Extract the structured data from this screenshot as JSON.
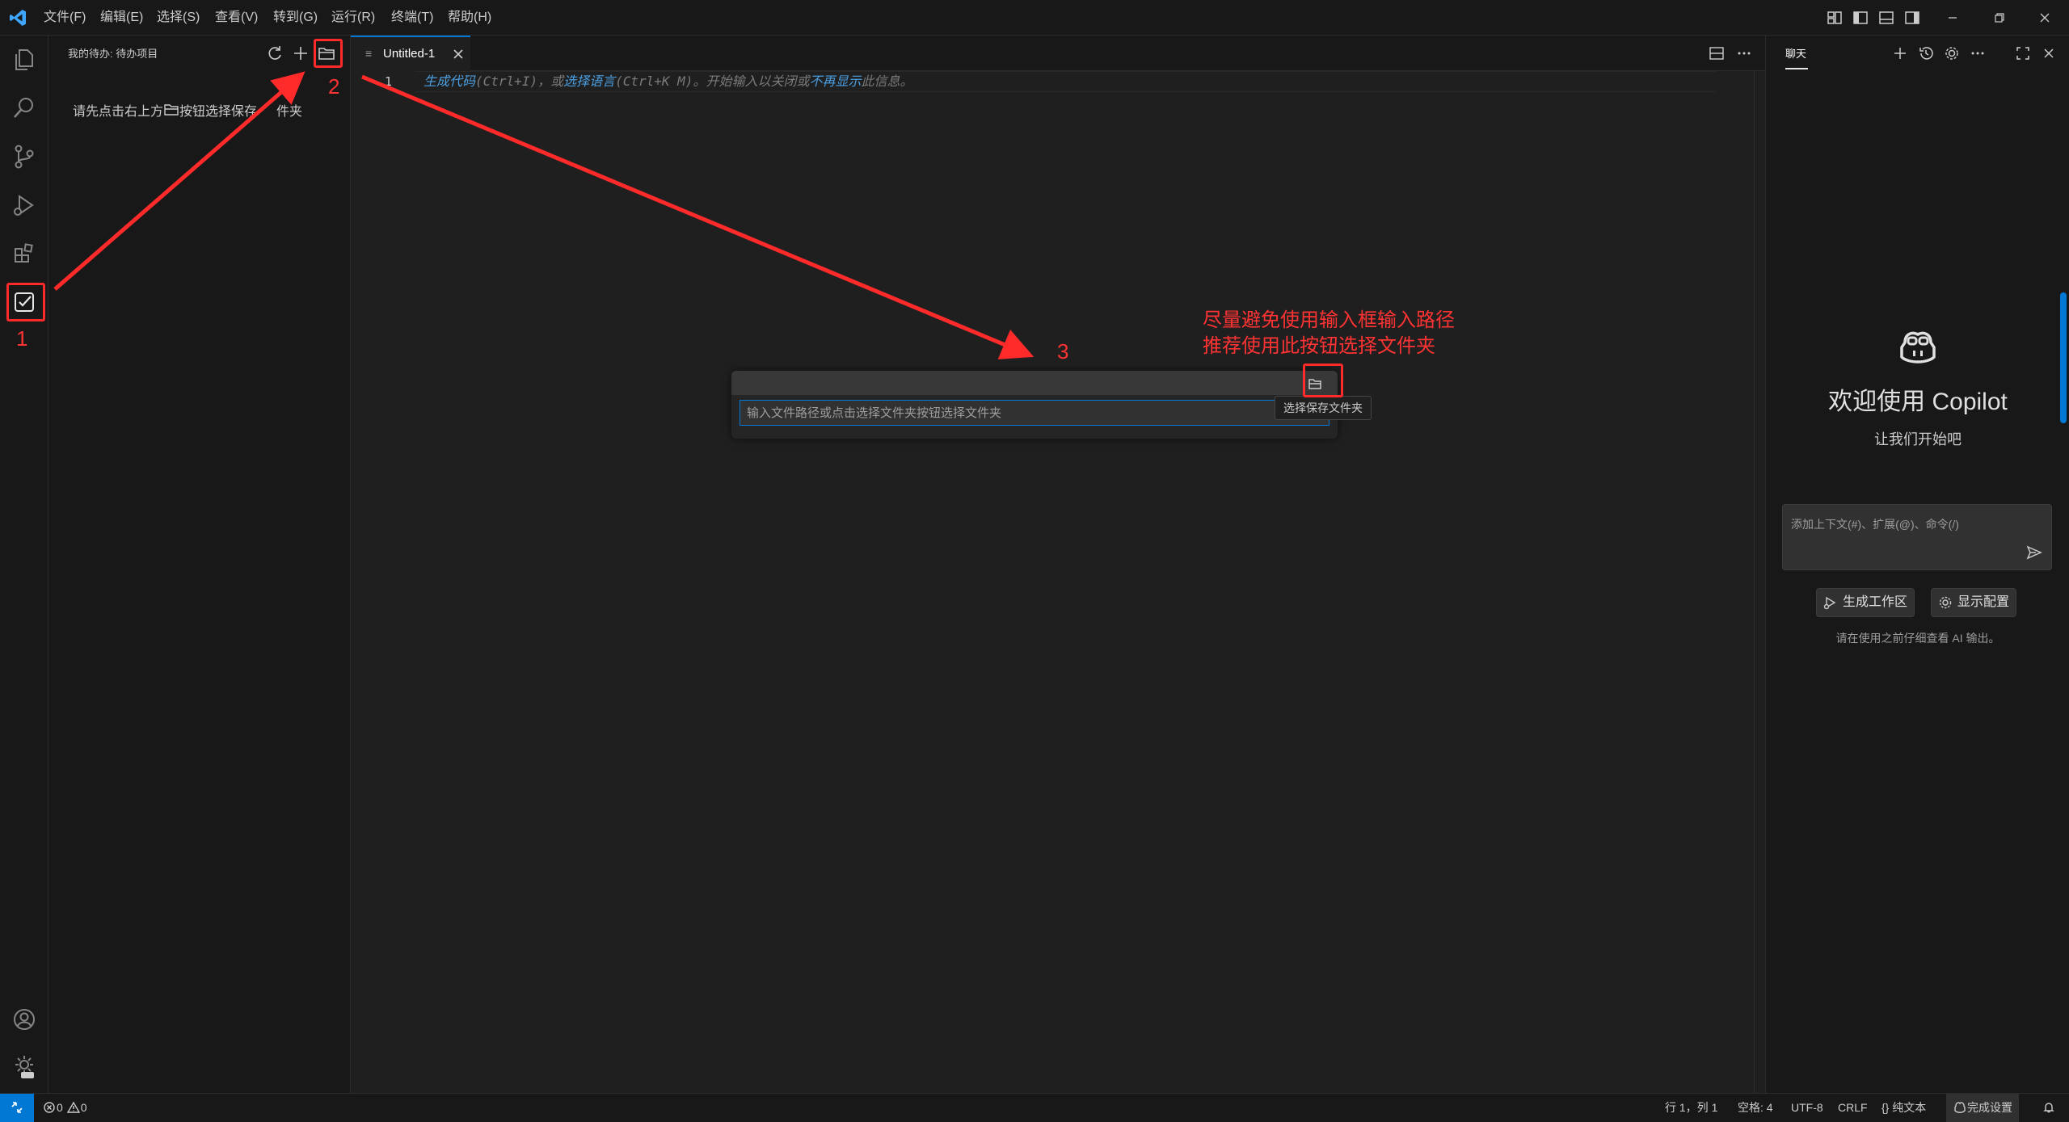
{
  "menu": [
    "文件(F)",
    "编辑(E)",
    "选择(S)",
    "查看(V)",
    "转到(G)",
    "运行(R)",
    "终端(T)",
    "帮助(H)"
  ],
  "sidebar": {
    "title": "我的待办: 待办项目",
    "hint_prefix": "请先点击右上方",
    "hint_suffix": "按钮选择保存",
    "hint_tail": "件夹"
  },
  "editor": {
    "tab_label": "Untitled-1",
    "line_number": "1",
    "hint": {
      "link1": "生成代码",
      "text1": "(Ctrl+I)，或",
      "link2": "选择语言",
      "text2": "(Ctrl+K M)。开始输入以关闭或",
      "link3": "不再显示",
      "text3": "此信息。"
    }
  },
  "quick_input": {
    "placeholder": "输入文件路径或点击选择文件夹按钮选择文件夹",
    "tooltip": "选择保存文件夹"
  },
  "chat": {
    "tab": "聊天",
    "welcome": "欢迎使用 Copilot",
    "subtitle": "让我们开始吧",
    "input_placeholder": "添加上下文(#)、扩展(@)、命令(/)",
    "btn_workspace": "生成工作区",
    "btn_config": "显示配置",
    "note": "请在使用之前仔细查看 AI 输出。"
  },
  "statusbar": {
    "errors": "0",
    "warnings": "0",
    "position": "行 1，列 1",
    "spaces": "空格: 4",
    "encoding": "UTF-8",
    "eol": "CRLF",
    "language": "纯文本",
    "copilot": "完成设置"
  },
  "annotations": {
    "step1": "1",
    "step2": "2",
    "step3": "3",
    "note_line1": "尽量避免使用输入框输入路径",
    "note_line2": "推荐使用此按钮选择文件夹"
  },
  "colors": {
    "accent": "#0078d4",
    "annotation": "#ff2a2a",
    "background": "#1f1f1f",
    "panel": "#181818"
  },
  "icons": {
    "activity": [
      "explorer-icon",
      "search-icon",
      "source-control-icon",
      "run-debug-icon",
      "extensions-icon",
      "todo-check-icon",
      "account-icon",
      "settings-icon"
    ],
    "sidebar_actions": [
      "refresh-icon",
      "add-icon",
      "folder-open-icon"
    ],
    "chat_actions": [
      "new-chat-icon",
      "history-icon",
      "gear-icon",
      "more-icon",
      "maximize-icon",
      "close-icon"
    ]
  }
}
